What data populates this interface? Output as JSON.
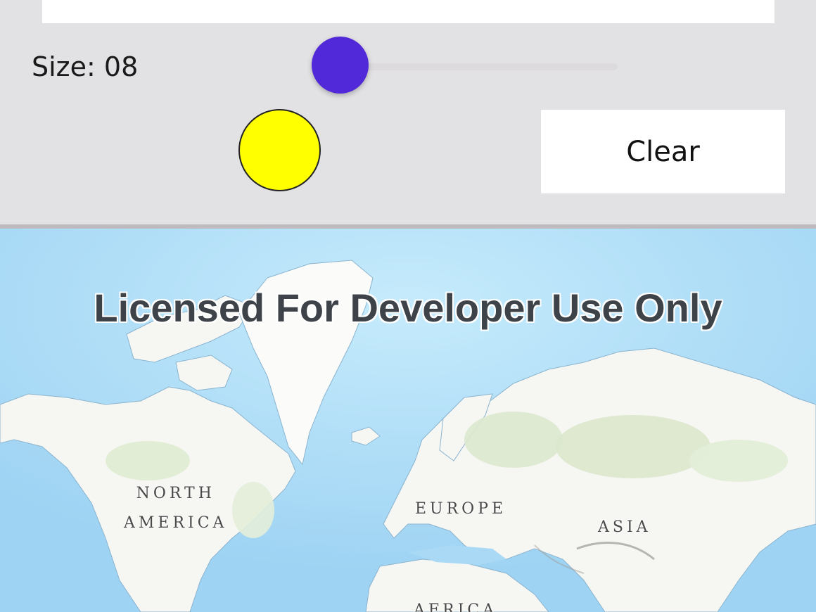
{
  "controls": {
    "size_label": "Size: 08",
    "size_value": 8,
    "size_fraction": 0.0,
    "swatch_color": "#ffff00",
    "clear_label": "Clear",
    "accent_color": "#5229d9"
  },
  "map": {
    "watermark": "Licensed For Developer Use Only",
    "labels": {
      "north_america_line1": "NORTH",
      "north_america_line2": "AMERICA",
      "europe": "EUROPE",
      "asia": "ASIA",
      "africa": "AFRICA"
    }
  }
}
